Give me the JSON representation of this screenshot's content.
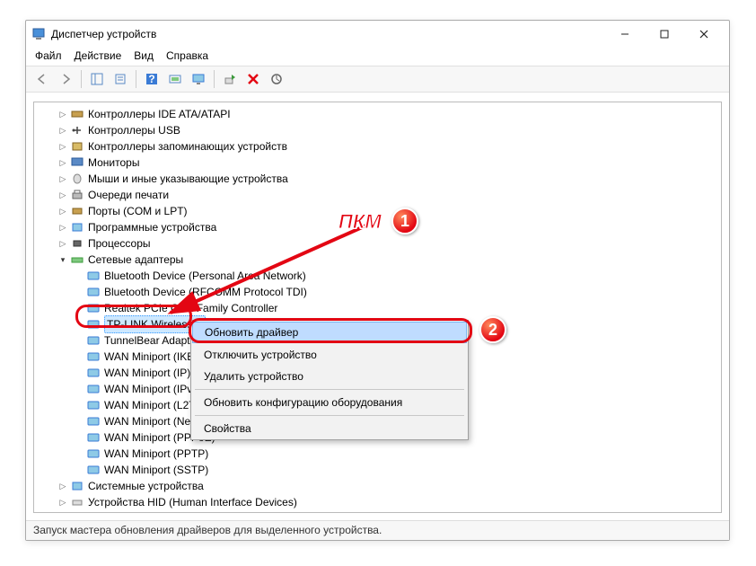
{
  "window": {
    "title": "Диспетчер устройств"
  },
  "menubar": [
    "Файл",
    "Действие",
    "Вид",
    "Справка"
  ],
  "tree": {
    "cat_ide": "Контроллеры IDE ATA/ATAPI",
    "cat_usb": "Контроллеры USB",
    "cat_storage": "Контроллеры запоминающих устройств",
    "cat_monitors": "Мониторы",
    "cat_mice": "Мыши и иные указывающие устройства",
    "cat_printq": "Очереди печати",
    "cat_ports": "Порты (COM и LPT)",
    "cat_software": "Программные устройства",
    "cat_cpu": "Процессоры",
    "cat_net": "Сетевые адаптеры",
    "net_items": [
      "Bluetooth Device (Personal Area Network)",
      "Bluetooth Device (RFCOMM Protocol TDI)",
      "Realtek PCIe GBE Family Controller",
      "TP-LINK Wireless U",
      "TunnelBear Adapter",
      "WAN Miniport (IKE",
      "WAN Miniport (IP)",
      "WAN Miniport (IPv",
      "WAN Miniport (L2T",
      "WAN Miniport (Net",
      "WAN Miniport (PPPoE)",
      "WAN Miniport (PPTP)",
      "WAN Miniport (SSTP)"
    ],
    "cat_system": "Системные устройства",
    "cat_hid": "Устройства HID (Human Interface Devices)"
  },
  "context_menu": {
    "update_driver": "Обновить драйвер",
    "disable": "Отключить устройство",
    "uninstall": "Удалить устройство",
    "scan": "Обновить конфигурацию оборудования",
    "properties": "Свойства"
  },
  "statusbar": "Запуск мастера обновления драйверов для выделенного устройства.",
  "callout": {
    "pkm": "ПКМ"
  }
}
